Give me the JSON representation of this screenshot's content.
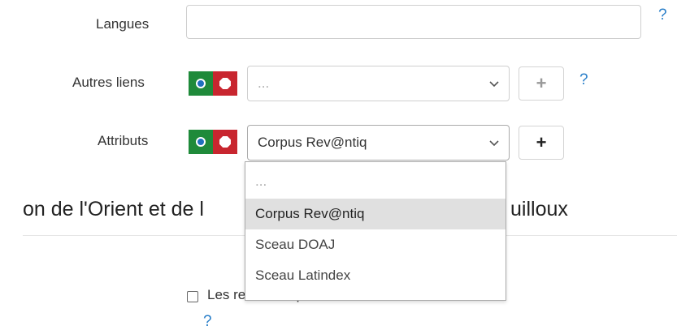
{
  "langues": {
    "label": "Langues",
    "value": "",
    "help": "?"
  },
  "autres_liens": {
    "label": "Autres liens",
    "select_value": "...",
    "add_symbol": "+",
    "help": "?"
  },
  "attributs": {
    "label": "Attributs",
    "select_value": "Corpus Rev@ntiq",
    "add_symbol": "+",
    "dropdown_options": [
      "...",
      "Corpus Rev@ntiq",
      "Sceau DOAJ",
      "Sceau Latindex"
    ],
    "highlighted_option": "Corpus Rev@ntiq"
  },
  "section": {
    "heading_left": "on de l'Orient et de l",
    "heading_right": "uilloux"
  },
  "filter": {
    "checkbox_label": "Les revues disponibles dans mon établissement",
    "checked": false,
    "help": "?"
  },
  "icons": {
    "chevron": "chevron-down-icon",
    "toggle_on": "radio-on-icon",
    "toggle_off": "stop-icon"
  },
  "colors": {
    "toggle_green": "#1f8a3a",
    "toggle_red": "#c8262f",
    "help_blue": "#2a7fc9",
    "highlight": "#e0e0e0"
  }
}
